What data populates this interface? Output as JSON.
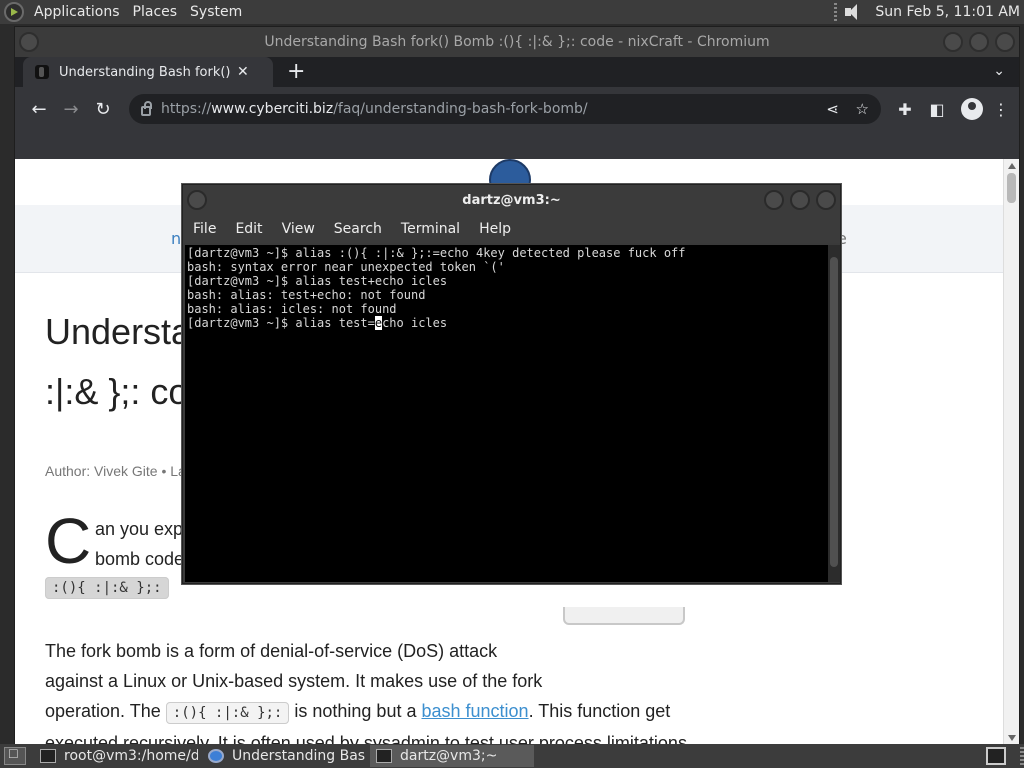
{
  "top_panel": {
    "menu": [
      "Applications",
      "Places",
      "System"
    ],
    "clock": "Sun Feb  5, 11:01 AM"
  },
  "chrome": {
    "window_title": "Understanding Bash fork() Bomb :(){ :|:& };: code - nixCraft - Chromium",
    "tab_title": "Understanding Bash fork() Bom",
    "url_prefix": "https://",
    "url_host": "www.cyberciti.biz",
    "url_path": "/faq/understanding-bash-fork-bomb/"
  },
  "page": {
    "nav_fragment_left": "n",
    "nav_fragment_right": "e",
    "title_line1": "Understa",
    "title_line2": ":|:& };: co",
    "meta": "Author: Vivek Gite • La",
    "dropcap": "C",
    "intro_line1": "an you exp",
    "intro_line2": "bomb code",
    "code_chip_highlight": ":(){ :|:& };:",
    "body_line1": "The fork bomb is a form of denial-of-service (DoS) attack",
    "body_line2": "against a Linux or Unix-based system. It makes use of the fork",
    "body_line3_before": "operation. The",
    "body_line3_code": ":(){ :|:& };:",
    "body_line3_mid": "is nothing but a",
    "body_line3_link": "bash function",
    "body_line3_after": ". This function get",
    "body_line4": "executed recursively. It is often used by sysadmin to test user process limitations"
  },
  "terminal": {
    "title": "dartz@vm3:~",
    "menu": [
      "File",
      "Edit",
      "View",
      "Search",
      "Terminal",
      "Help"
    ],
    "lines": [
      "[dartz@vm3 ~]$ alias :(){ :|:& };:=echo 4key detected please fuck off",
      "bash: syntax error near unexpected token `('",
      "[dartz@vm3 ~]$ alias test+echo icles",
      "bash: alias: test+echo: not found",
      "bash: alias: icles: not found"
    ],
    "current_prompt_before_cursor": "[dartz@vm3 ~]$ alias test=",
    "cursor_char": "e",
    "current_prompt_after_cursor": "cho icles"
  },
  "taskbar": {
    "tasks": [
      "root@vm3:/home/d...",
      "Understanding Bas...",
      "dartz@vm3;~"
    ]
  }
}
